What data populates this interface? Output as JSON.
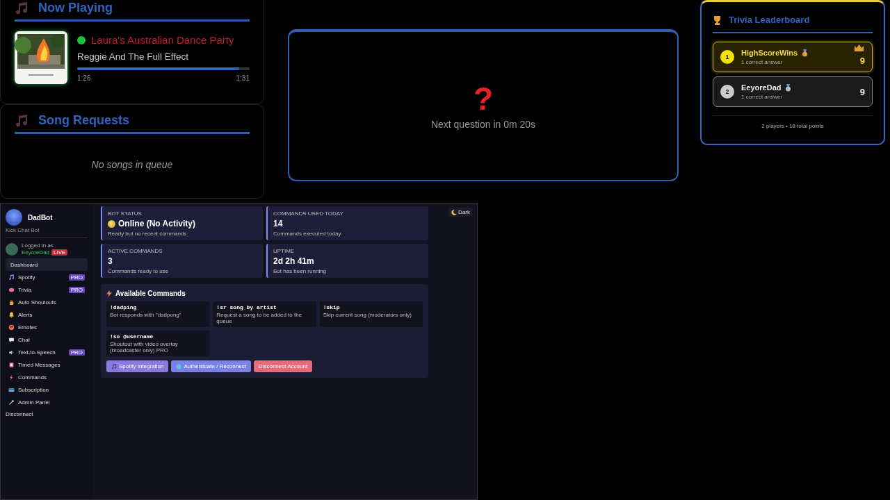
{
  "now_playing": {
    "title": "Now Playing",
    "playing": true,
    "track": "Laura's Australian Dance Party",
    "artist": "Reggie And The Full Effect",
    "level": 0.94,
    "elapsed": "1:26",
    "duration": "1:31"
  },
  "song_requests": {
    "title": "Song Requests",
    "empty_text": "No songs in queue"
  },
  "trivia": {
    "symbol": "?",
    "countdown": "Next question in 0m 20s"
  },
  "leaderboard": {
    "title": "Trivia Leaderboard",
    "players": [
      {
        "rank": "1",
        "name": "HighScoreWins",
        "subtitle": "1 correct answer",
        "score": "9",
        "leader": true
      },
      {
        "rank": "2",
        "name": "EeyoreDad",
        "subtitle": "1 correct answer",
        "score": "9",
        "leader": false
      }
    ],
    "footer": "2 players • 18 total points"
  },
  "dashboard": {
    "brand": "DadBot",
    "tagline": "Kick Chat Bot",
    "logged_in_label": "Logged in as",
    "username": "EeyoreDad",
    "live_badge": "LIVE",
    "nav": [
      {
        "label": "Dashboard",
        "selected": true
      },
      {
        "label": "Spotify",
        "selected": false,
        "badge": "PRO"
      },
      {
        "label": "Trivia",
        "selected": false,
        "badge": "PRO"
      },
      {
        "label": "Auto Shoutouts",
        "selected": false
      },
      {
        "label": "Alerts",
        "selected": false
      },
      {
        "label": "Emotes",
        "selected": false
      },
      {
        "label": "Chat",
        "selected": false
      },
      {
        "label": "Text-to-Speech",
        "selected": false,
        "badge": "PRO"
      },
      {
        "label": "Timed Messages",
        "selected": false
      },
      {
        "label": "Commands",
        "selected": false
      },
      {
        "label": "Subscription",
        "selected": false
      },
      {
        "label": "Admin Panel",
        "selected": false
      }
    ],
    "disconnect": "Disconnect",
    "theme_toggle": "Dark",
    "stats": [
      {
        "label": "BOT STATUS",
        "value": "Online (No Activity)",
        "note": "Ready but no recent commands",
        "status_dot": true
      },
      {
        "label": "COMMANDS USED TODAY",
        "value": "14",
        "note": "Commands executed today"
      },
      {
        "label": "ACTIVE COMMANDS",
        "value": "3",
        "note": "Commands ready to use"
      },
      {
        "label": "UPTIME",
        "value": "2d 2h 41m",
        "note": "Bot has been running"
      }
    ],
    "commands_title": "Available Commands",
    "commands": [
      {
        "command": "!dadping",
        "description": "Bot responds with \"dadpong\""
      },
      {
        "command": "!sr song by artist",
        "description": "Request a song to be added to the queue"
      },
      {
        "command": "!skip",
        "description": "Skip current song (moderators only)"
      },
      {
        "command": "!so @username",
        "description": "Shoutout with video overlay (broadcaster only) PRO"
      }
    ],
    "buttons": [
      {
        "label": "Spotify Integration",
        "kind": "spotify"
      },
      {
        "label": "Authenticate / Reconnect",
        "kind": "auth"
      },
      {
        "label": "Disconnect Account",
        "kind": "danger"
      }
    ]
  }
}
